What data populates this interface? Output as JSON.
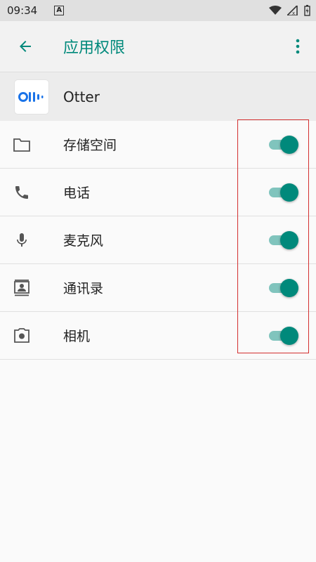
{
  "status_bar": {
    "time": "09:34",
    "notification_icon": "A"
  },
  "app_bar": {
    "title": "应用权限"
  },
  "app": {
    "name": "Otter",
    "logo_text": "Oll•"
  },
  "permissions": [
    {
      "label": "存储空间",
      "icon": "folder-icon",
      "enabled": true
    },
    {
      "label": "电话",
      "icon": "phone-icon",
      "enabled": true
    },
    {
      "label": "麦克风",
      "icon": "microphone-icon",
      "enabled": true
    },
    {
      "label": "通讯录",
      "icon": "contacts-icon",
      "enabled": true
    },
    {
      "label": "相机",
      "icon": "camera-icon",
      "enabled": true
    }
  ],
  "colors": {
    "accent": "#00897b",
    "toggle_track": "#80c4bd",
    "highlight": "#d32f2f",
    "otter_blue": "#1a73e8"
  }
}
